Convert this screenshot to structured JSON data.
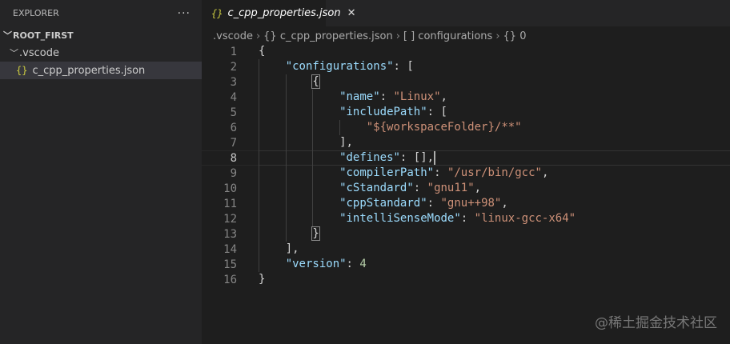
{
  "sidebar": {
    "title": "EXPLORER",
    "more": "···",
    "root": "ROOT_FIRST",
    "folder": ".vscode",
    "file": "c_cpp_properties.json",
    "file_icon": "{}"
  },
  "tab": {
    "icon": "{}",
    "label": "c_cpp_properties.json",
    "close": "✕"
  },
  "breadcrumb": [
    ".vscode",
    "{} c_cpp_properties.json",
    "[ ] configurations",
    "{} 0"
  ],
  "editor": {
    "current_line": 8,
    "lines": [
      {
        "n": "1",
        "ind": 0,
        "t": [
          [
            "p",
            "{"
          ]
        ]
      },
      {
        "n": "2",
        "ind": 1,
        "t": [
          [
            "k",
            "\"configurations\""
          ],
          [
            "p",
            ": ["
          ]
        ]
      },
      {
        "n": "3",
        "ind": 2,
        "t": [
          [
            "p hl",
            "{"
          ]
        ]
      },
      {
        "n": "4",
        "ind": 3,
        "t": [
          [
            "k",
            "\"name\""
          ],
          [
            "p",
            ": "
          ],
          [
            "s",
            "\"Linux\""
          ],
          [
            "p",
            ","
          ]
        ]
      },
      {
        "n": "5",
        "ind": 3,
        "t": [
          [
            "k",
            "\"includePath\""
          ],
          [
            "p",
            ": ["
          ]
        ]
      },
      {
        "n": "6",
        "ind": 4,
        "t": [
          [
            "s",
            "\"${workspaceFolder}/**\""
          ]
        ]
      },
      {
        "n": "7",
        "ind": 3,
        "t": [
          [
            "p",
            "],"
          ]
        ]
      },
      {
        "n": "8",
        "ind": 3,
        "t": [
          [
            "k",
            "\"defines\""
          ],
          [
            "p",
            ": [],"
          ]
        ],
        "caret": true
      },
      {
        "n": "9",
        "ind": 3,
        "t": [
          [
            "k",
            "\"compilerPath\""
          ],
          [
            "p",
            ": "
          ],
          [
            "s",
            "\"/usr/bin/gcc\""
          ],
          [
            "p",
            ","
          ]
        ]
      },
      {
        "n": "10",
        "ind": 3,
        "t": [
          [
            "k",
            "\"cStandard\""
          ],
          [
            "p",
            ": "
          ],
          [
            "s",
            "\"gnu11\""
          ],
          [
            "p",
            ","
          ]
        ]
      },
      {
        "n": "11",
        "ind": 3,
        "t": [
          [
            "k",
            "\"cppStandard\""
          ],
          [
            "p",
            ": "
          ],
          [
            "s",
            "\"gnu++98\""
          ],
          [
            "p",
            ","
          ]
        ]
      },
      {
        "n": "12",
        "ind": 3,
        "t": [
          [
            "k",
            "\"intelliSenseMode\""
          ],
          [
            "p",
            ": "
          ],
          [
            "s",
            "\"linux-gcc-x64\""
          ]
        ]
      },
      {
        "n": "13",
        "ind": 2,
        "t": [
          [
            "p hl",
            "}"
          ]
        ]
      },
      {
        "n": "14",
        "ind": 1,
        "t": [
          [
            "p",
            "],"
          ]
        ]
      },
      {
        "n": "15",
        "ind": 1,
        "t": [
          [
            "k",
            "\"version\""
          ],
          [
            "p",
            ": "
          ],
          [
            "n",
            "4"
          ]
        ]
      },
      {
        "n": "16",
        "ind": 0,
        "t": [
          [
            "p",
            "}"
          ]
        ]
      }
    ]
  },
  "watermark": "@稀土掘金技术社区"
}
